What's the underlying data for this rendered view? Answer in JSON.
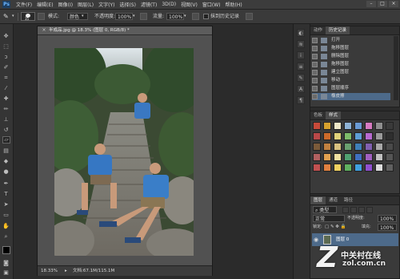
{
  "app": {
    "logo": "Ps"
  },
  "menu": [
    "文件(F)",
    "编辑(E)",
    "图像(I)",
    "图层(L)",
    "文字(Y)",
    "选择(S)",
    "滤镜(T)",
    "3D(D)",
    "视图(V)",
    "窗口(W)",
    "帮助(H)"
  ],
  "window_controls": [
    "–",
    "□",
    "×"
  ],
  "options": {
    "brush_size": "35",
    "mode_label": "模式:",
    "mode_value": "颜色",
    "opacity_label": "不透明度:",
    "opacity_value": "100%",
    "flow_label": "流量:",
    "flow_value": "100%",
    "history_label": "抹到历史记录"
  },
  "document": {
    "tab_title": "半成品.jpg @ 18.3% (图层 0, RGB/8) *",
    "close": "×",
    "zoom": "18.33%",
    "doc_info": "文档:67.1M/115.1M"
  },
  "history": {
    "tabs": [
      "动作",
      "历史记录"
    ],
    "items": [
      "打开",
      "拖移图层",
      "删除图层",
      "拖移图层",
      "建立图层",
      "移动",
      "图层顺序",
      "橡皮擦"
    ]
  },
  "swatches": {
    "tabs": [
      "色板",
      "样式"
    ],
    "colors": [
      "#c84a3a",
      "#d6a12e",
      "#efe8c8",
      "#8fb3d6",
      "#6a9ad4",
      "#d77bc2",
      "#8e8e8e",
      "#3a3a3a",
      "#b84848",
      "#cc6a2a",
      "#e0d27a",
      "#7dbb6a",
      "#5e9ed6",
      "#b76ad0",
      "#9a9a9a",
      "#2e2e2e",
      "#7a5a3a",
      "#c08040",
      "#d8c080",
      "#6aa070",
      "#3f7fb8",
      "#8060b0",
      "#a8a8a8",
      "#4a4a4a",
      "#b06060",
      "#e0a050",
      "#f0e0a0",
      "#50a070",
      "#4070c0",
      "#a060c0",
      "#c0c0c0",
      "#555555",
      "#c05050",
      "#e08040",
      "#f0d060",
      "#60b060",
      "#40a0e0",
      "#9050d0",
      "#dddddd",
      "#606060"
    ]
  },
  "layers": {
    "tabs": [
      "图层",
      "通道",
      "路径"
    ],
    "kind_label": "类型",
    "blend_mode": "正常",
    "opacity_label": "不透明度:",
    "opacity_value": "100%",
    "lock_label": "锁定:",
    "fill_label": "填充:",
    "fill_value": "100%",
    "layer_name": "图层 0"
  },
  "watermark": {
    "logo_text": "Z",
    "site_cn": "中关村在线",
    "site_url": "zol.com.cn"
  }
}
